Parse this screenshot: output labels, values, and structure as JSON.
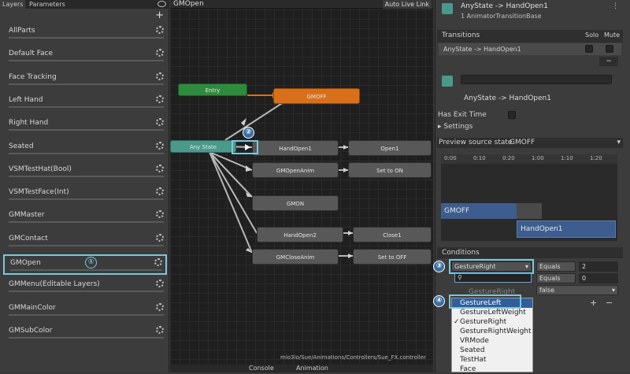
{
  "left_panel": {
    "tabs": [
      "Layers",
      "Parameters"
    ],
    "add_label": "+",
    "layers": [
      "AllParts",
      "Default Face",
      "Face Tracking",
      "Left Hand",
      "Right Hand",
      "Seated",
      "VSMTestHat(Bool)",
      "VSMTestFace(Int)",
      "GMMaster",
      "GMContact",
      "GMOpen",
      "GMMenu(Editable Layers)",
      "GMMainColor",
      "GMSubColor"
    ]
  },
  "graph": {
    "breadcrumb": "GMOpen",
    "auto_live_link": "Auto Live Link",
    "path": "mio3io/Sue/Animations/Controllers/Sue_FX.controller",
    "nodes": {
      "entry": "Entry",
      "gmoff": "GMOFF",
      "any_state": "Any State",
      "handopen1": "HandOpen1",
      "open1": "Open1",
      "gmopenanim": "GMOpenAnim",
      "set_to_on": "Set to ON",
      "gmon": "GMON",
      "handopen2": "HandOpen2",
      "close1": "Close1",
      "gmcloseanim": "GMCloseAnim",
      "set_to_off": "Set to OFF"
    },
    "bottom_tabs": [
      "Console",
      "Animation"
    ]
  },
  "inspector": {
    "title": "AnyState -> HandOpen1",
    "subtitle": "1 AnimatorTransitionBase",
    "transitions_header": "Transitions",
    "solo": "Solo",
    "mute": "Mute",
    "transition_row": "AnyState -> HandOpen1",
    "minus": "−",
    "sub_title": "AnyState -> HandOpen1",
    "has_exit_time": "Has Exit Time",
    "settings": "Settings",
    "preview_label": "Preview source state",
    "preview_value": "GMOFF",
    "timeline_ticks": [
      "0:00",
      "0:10",
      "0:20",
      "1:00",
      "1:10",
      "1:20"
    ],
    "clip_a": "GMOFF",
    "clip_b": "HandOpen1",
    "conditions_header": "Conditions",
    "cond1": {
      "param": "GestureRight",
      "op": "Equals",
      "value": "2"
    },
    "cond2": {
      "op": "Equals",
      "value": "0"
    },
    "cond3": {
      "value": "false"
    },
    "search_placeholder": "",
    "dropdown_header": "GestureRight",
    "dropdown_items": [
      "GestureLeft",
      "GestureLeftWeight",
      "GestureRight",
      "GestureRightWeight",
      "VRMode",
      "Seated",
      "TestHat",
      "Face"
    ],
    "checked_item": "GestureRight",
    "plus": "+",
    "minus2": "−"
  },
  "markers": [
    "①",
    "②",
    "③",
    "④"
  ],
  "colors": {
    "highlight": "#7ac8dc",
    "entry": "#2e8b3d",
    "default_state": "#d8701a",
    "any_state": "#4a9a8c",
    "clip_blue": "#3c5d8e",
    "selection": "#2f5e9c"
  }
}
